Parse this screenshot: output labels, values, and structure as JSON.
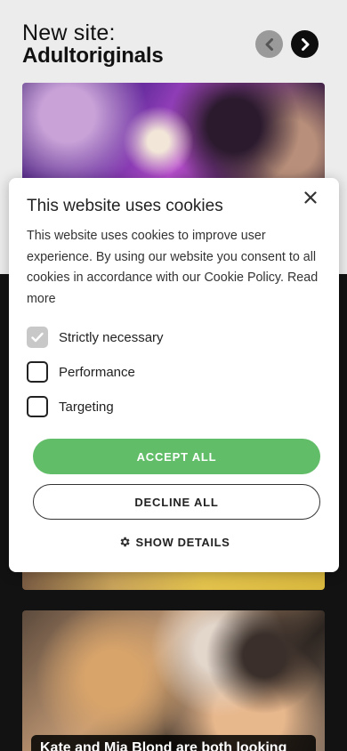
{
  "header": {
    "line1": "New site:",
    "line2": "Adultoriginals"
  },
  "carousel": {
    "prev_icon": "chevron-left-icon",
    "next_icon": "chevron-right-icon"
  },
  "video_card": {
    "caption": "Kate and Mia Blond are both looking"
  },
  "cookie_modal": {
    "title": "This website uses cookies",
    "description": "This website uses cookies to improve user experience. By using our website you consent to all cookies in accordance with our Cookie Policy.",
    "read_more": "Read more",
    "options": [
      {
        "label": "Strictly necessary",
        "checked": true,
        "disabled": true
      },
      {
        "label": "Performance",
        "checked": false
      },
      {
        "label": "Targeting",
        "checked": false
      }
    ],
    "accept_label": "ACCEPT ALL",
    "decline_label": "DECLINE ALL",
    "details_label": "SHOW DETAILS",
    "accent_color": "#62bd69"
  }
}
